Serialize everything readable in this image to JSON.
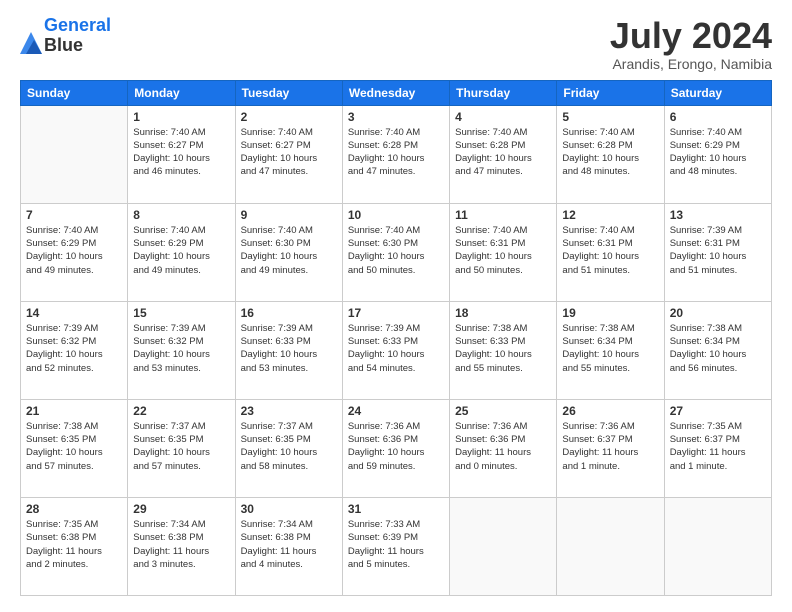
{
  "app": {
    "logo_text_1": "General",
    "logo_text_2": "Blue"
  },
  "header": {
    "title": "July 2024",
    "location": "Arandis, Erongo, Namibia"
  },
  "days_of_week": [
    "Sunday",
    "Monday",
    "Tuesday",
    "Wednesday",
    "Thursday",
    "Friday",
    "Saturday"
  ],
  "weeks": [
    [
      {
        "day": "",
        "info": ""
      },
      {
        "day": "1",
        "info": "Sunrise: 7:40 AM\nSunset: 6:27 PM\nDaylight: 10 hours\nand 46 minutes."
      },
      {
        "day": "2",
        "info": "Sunrise: 7:40 AM\nSunset: 6:27 PM\nDaylight: 10 hours\nand 47 minutes."
      },
      {
        "day": "3",
        "info": "Sunrise: 7:40 AM\nSunset: 6:28 PM\nDaylight: 10 hours\nand 47 minutes."
      },
      {
        "day": "4",
        "info": "Sunrise: 7:40 AM\nSunset: 6:28 PM\nDaylight: 10 hours\nand 47 minutes."
      },
      {
        "day": "5",
        "info": "Sunrise: 7:40 AM\nSunset: 6:28 PM\nDaylight: 10 hours\nand 48 minutes."
      },
      {
        "day": "6",
        "info": "Sunrise: 7:40 AM\nSunset: 6:29 PM\nDaylight: 10 hours\nand 48 minutes."
      }
    ],
    [
      {
        "day": "7",
        "info": "Sunrise: 7:40 AM\nSunset: 6:29 PM\nDaylight: 10 hours\nand 49 minutes."
      },
      {
        "day": "8",
        "info": "Sunrise: 7:40 AM\nSunset: 6:29 PM\nDaylight: 10 hours\nand 49 minutes."
      },
      {
        "day": "9",
        "info": "Sunrise: 7:40 AM\nSunset: 6:30 PM\nDaylight: 10 hours\nand 49 minutes."
      },
      {
        "day": "10",
        "info": "Sunrise: 7:40 AM\nSunset: 6:30 PM\nDaylight: 10 hours\nand 50 minutes."
      },
      {
        "day": "11",
        "info": "Sunrise: 7:40 AM\nSunset: 6:31 PM\nDaylight: 10 hours\nand 50 minutes."
      },
      {
        "day": "12",
        "info": "Sunrise: 7:40 AM\nSunset: 6:31 PM\nDaylight: 10 hours\nand 51 minutes."
      },
      {
        "day": "13",
        "info": "Sunrise: 7:39 AM\nSunset: 6:31 PM\nDaylight: 10 hours\nand 51 minutes."
      }
    ],
    [
      {
        "day": "14",
        "info": "Sunrise: 7:39 AM\nSunset: 6:32 PM\nDaylight: 10 hours\nand 52 minutes."
      },
      {
        "day": "15",
        "info": "Sunrise: 7:39 AM\nSunset: 6:32 PM\nDaylight: 10 hours\nand 53 minutes."
      },
      {
        "day": "16",
        "info": "Sunrise: 7:39 AM\nSunset: 6:33 PM\nDaylight: 10 hours\nand 53 minutes."
      },
      {
        "day": "17",
        "info": "Sunrise: 7:39 AM\nSunset: 6:33 PM\nDaylight: 10 hours\nand 54 minutes."
      },
      {
        "day": "18",
        "info": "Sunrise: 7:38 AM\nSunset: 6:33 PM\nDaylight: 10 hours\nand 55 minutes."
      },
      {
        "day": "19",
        "info": "Sunrise: 7:38 AM\nSunset: 6:34 PM\nDaylight: 10 hours\nand 55 minutes."
      },
      {
        "day": "20",
        "info": "Sunrise: 7:38 AM\nSunset: 6:34 PM\nDaylight: 10 hours\nand 56 minutes."
      }
    ],
    [
      {
        "day": "21",
        "info": "Sunrise: 7:38 AM\nSunset: 6:35 PM\nDaylight: 10 hours\nand 57 minutes."
      },
      {
        "day": "22",
        "info": "Sunrise: 7:37 AM\nSunset: 6:35 PM\nDaylight: 10 hours\nand 57 minutes."
      },
      {
        "day": "23",
        "info": "Sunrise: 7:37 AM\nSunset: 6:35 PM\nDaylight: 10 hours\nand 58 minutes."
      },
      {
        "day": "24",
        "info": "Sunrise: 7:36 AM\nSunset: 6:36 PM\nDaylight: 10 hours\nand 59 minutes."
      },
      {
        "day": "25",
        "info": "Sunrise: 7:36 AM\nSunset: 6:36 PM\nDaylight: 11 hours\nand 0 minutes."
      },
      {
        "day": "26",
        "info": "Sunrise: 7:36 AM\nSunset: 6:37 PM\nDaylight: 11 hours\nand 1 minute."
      },
      {
        "day": "27",
        "info": "Sunrise: 7:35 AM\nSunset: 6:37 PM\nDaylight: 11 hours\nand 1 minute."
      }
    ],
    [
      {
        "day": "28",
        "info": "Sunrise: 7:35 AM\nSunset: 6:38 PM\nDaylight: 11 hours\nand 2 minutes."
      },
      {
        "day": "29",
        "info": "Sunrise: 7:34 AM\nSunset: 6:38 PM\nDaylight: 11 hours\nand 3 minutes."
      },
      {
        "day": "30",
        "info": "Sunrise: 7:34 AM\nSunset: 6:38 PM\nDaylight: 11 hours\nand 4 minutes."
      },
      {
        "day": "31",
        "info": "Sunrise: 7:33 AM\nSunset: 6:39 PM\nDaylight: 11 hours\nand 5 minutes."
      },
      {
        "day": "",
        "info": ""
      },
      {
        "day": "",
        "info": ""
      },
      {
        "day": "",
        "info": ""
      }
    ]
  ]
}
